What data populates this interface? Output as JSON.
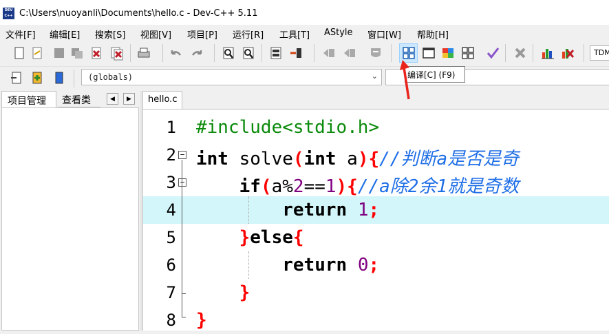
{
  "window": {
    "title": "C:\\Users\\nuoyanli\\Documents\\hello.c - Dev-C++ 5.11",
    "icon_label": "DEV C++"
  },
  "menu": [
    "文件[F]",
    "编辑[E]",
    "搜索[S]",
    "视图[V]",
    "项目[P]",
    "运行[R]",
    "工具[T]",
    "AStyle",
    "窗口[W]",
    "帮助[H]"
  ],
  "toolbar": {
    "compiler_combo_text": "TDM",
    "tooltip": "编译[C] (F9)",
    "icons": [
      "new-file",
      "open-file",
      "save",
      "save-all",
      "close",
      "close-all",
      "print",
      "undo",
      "redo",
      "find",
      "replace",
      "goto-line",
      "goto-next",
      "indent",
      "unindent",
      "toggle-comment",
      "compile",
      "run",
      "compile-run",
      "rebuild-all",
      "syntax-check",
      "stop",
      "profile",
      "delete-profile"
    ]
  },
  "toolbar2": {
    "globals_combo": "(globals)"
  },
  "left_panel": {
    "tabs": [
      "项目管理",
      "查看类"
    ],
    "nav_prev": "◀",
    "nav_next": "▶"
  },
  "editor": {
    "tab": "hello.c",
    "highlight_line": 4,
    "line_numbers": [
      "1",
      "2",
      "3",
      "4",
      "5",
      "6",
      "7",
      "8"
    ],
    "lines": [
      {
        "pp": "#include<stdio.h>"
      },
      {
        "kw1": "int",
        "t1": " solve",
        "br1": "(",
        "kw2": "int",
        "t2": " a",
        "br2": "){",
        "cm": "//判断a是否是奇"
      },
      {
        "indent": "    ",
        "kw1": "if",
        "br1": "(",
        "t1": "a%",
        "num1": "2",
        "t2": "==",
        "num2": "1",
        "br2": "){",
        "cm": "//a除2余1就是奇数"
      },
      {
        "indent": "        ",
        "kw1": "return",
        "t1": " ",
        "num1": "1",
        "t2": ";"
      },
      {
        "indent": "    ",
        "br1": "}",
        "kw1": "else",
        "br2": "{"
      },
      {
        "indent": "        ",
        "kw1": "return",
        "t1": " ",
        "num1": "0",
        "t2": ";"
      },
      {
        "indent": "    ",
        "br1": "}"
      },
      {
        "br1": "}"
      }
    ]
  },
  "colors": {
    "highlight_line": "#d2f6f9",
    "keyword": "#000000",
    "preprocessor": "#0a8a0a",
    "brace": "#ff0000",
    "number": "#800080",
    "comment": "#1e6ee6",
    "arrow": "#e8241c"
  }
}
